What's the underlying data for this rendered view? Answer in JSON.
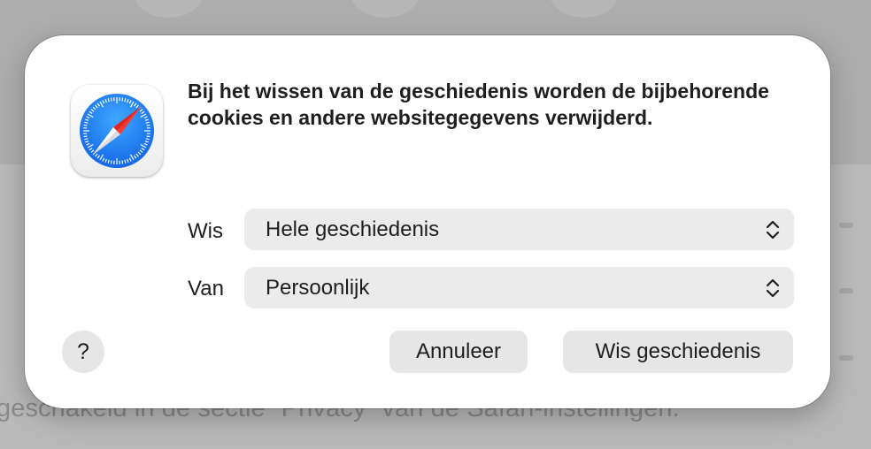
{
  "background": {
    "partial_text": "geschakeld in de sectie “Privacy” van de Safari-instellingen."
  },
  "dialog": {
    "app_icon": "safari-compass-icon",
    "message": "Bij het wissen van de geschiedenis worden de bijbehorende cookies en andere websitegegevens verwijderd.",
    "clear_row": {
      "label": "Wis",
      "selected": "Hele geschiedenis"
    },
    "profile_row": {
      "label": "Van",
      "selected": "Persoonlijk"
    },
    "help_label": "?",
    "cancel_label": "Annuleer",
    "confirm_label": "Wis geschiedenis"
  },
  "colors": {
    "dialog_bg": "#ffffff",
    "control_bg": "#ebebeb",
    "text": "#1e1e1e",
    "safari_blue": "#1a8cf8",
    "compass_red": "#ff3b30"
  }
}
